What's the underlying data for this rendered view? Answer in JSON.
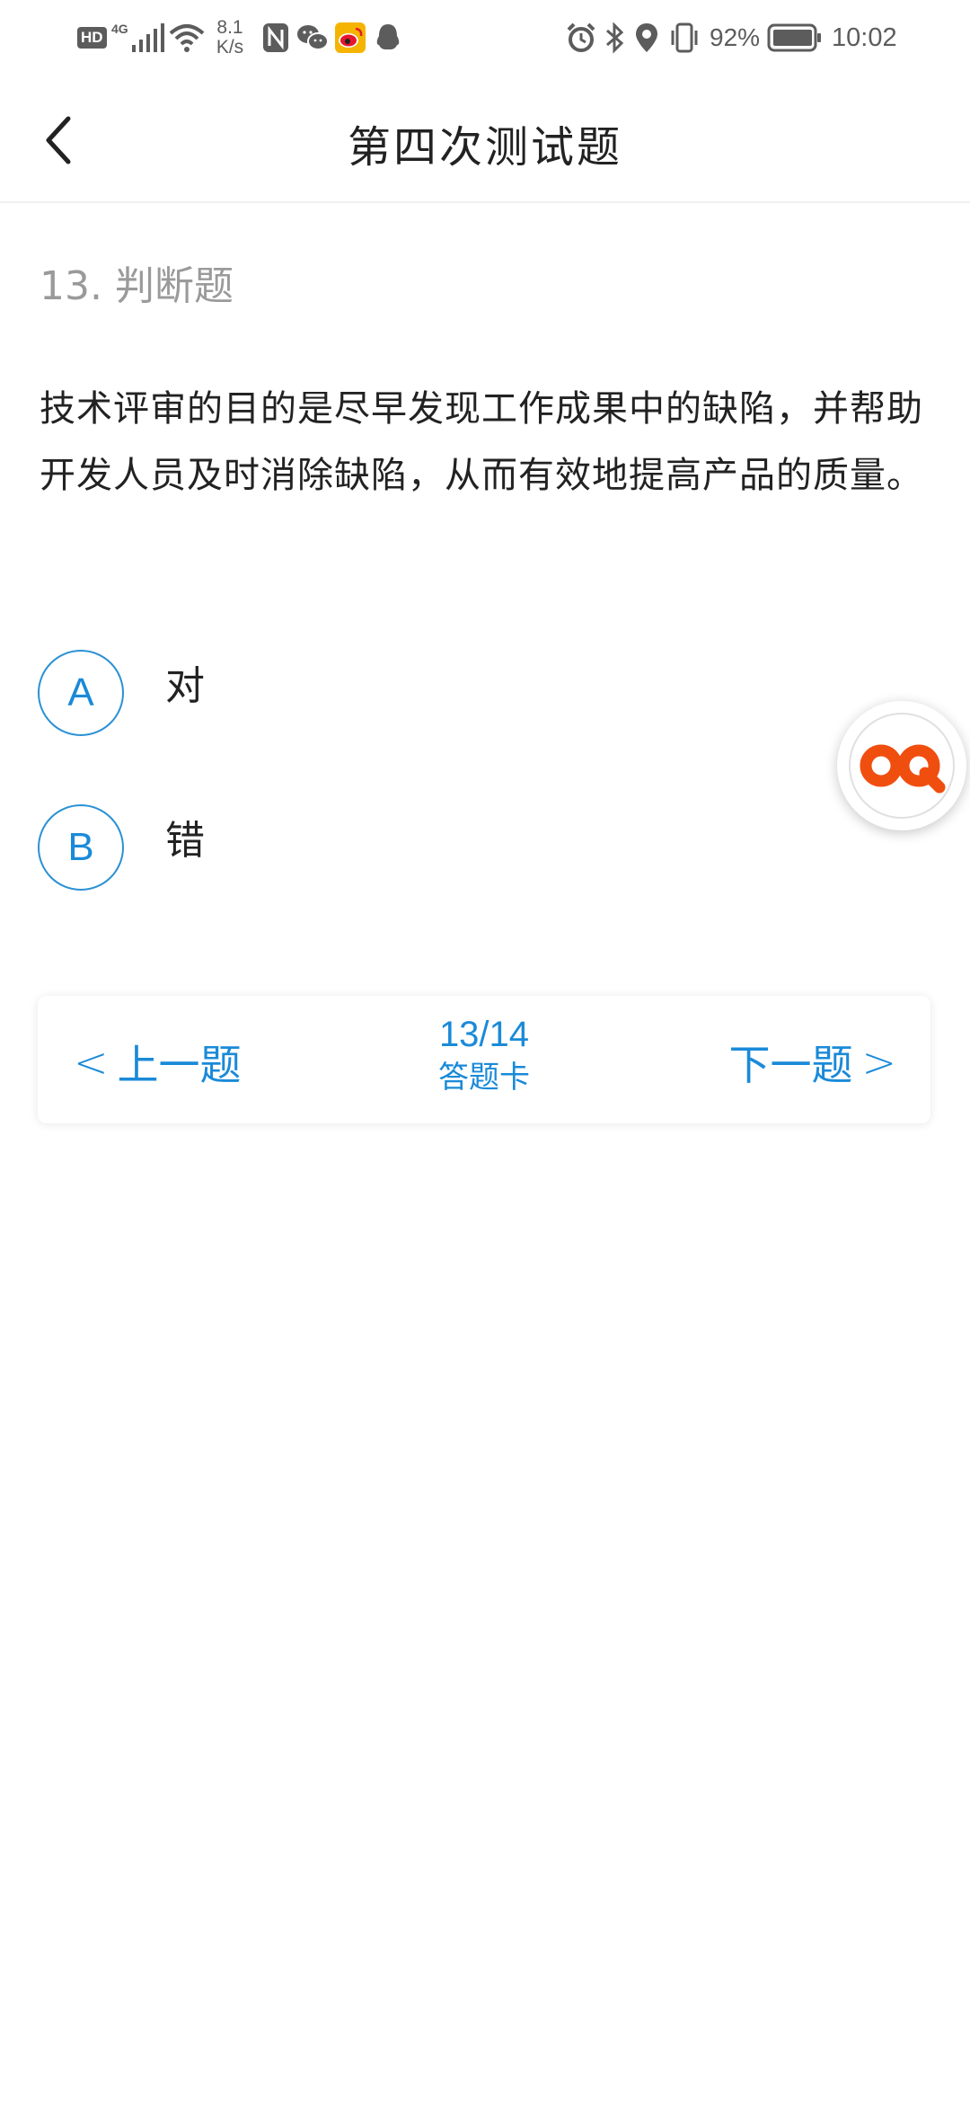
{
  "status_bar": {
    "hd": "HD",
    "network": "4G",
    "net_speed_value": "8.1",
    "net_speed_unit": "K/s",
    "battery_percent": "92%",
    "time": "10:02",
    "icons": [
      "hd-icon",
      "signal-icon",
      "wifi-icon",
      "nfc-icon",
      "wechat-icon",
      "weibo-icon",
      "qq-icon",
      "alarm-icon",
      "bluetooth-icon",
      "location-icon",
      "vibrate-icon",
      "battery-icon"
    ]
  },
  "header": {
    "title": "第四次测试题",
    "back_icon": "chevron-left-icon"
  },
  "question": {
    "type_label": "13. 判断题",
    "text": "技术评审的目的是尽早发现工作成果中的缺陷，并帮助开发人员及时消除缺陷，从而有效地提高产品的质量。"
  },
  "options": [
    {
      "letter": "A",
      "text": "对"
    },
    {
      "letter": "B",
      "text": "错"
    }
  ],
  "floating_button": {
    "icon": "infinity-logo-icon",
    "color": "#f04e0f"
  },
  "nav": {
    "prev_arrow": "<",
    "prev_label": "上一题",
    "counter": "13/14",
    "card_label": "答题卡",
    "next_label": "下一题",
    "next_arrow": ">"
  },
  "colors": {
    "accent": "#1a8ad8",
    "text": "#222222",
    "muted": "#9a9a9a"
  }
}
